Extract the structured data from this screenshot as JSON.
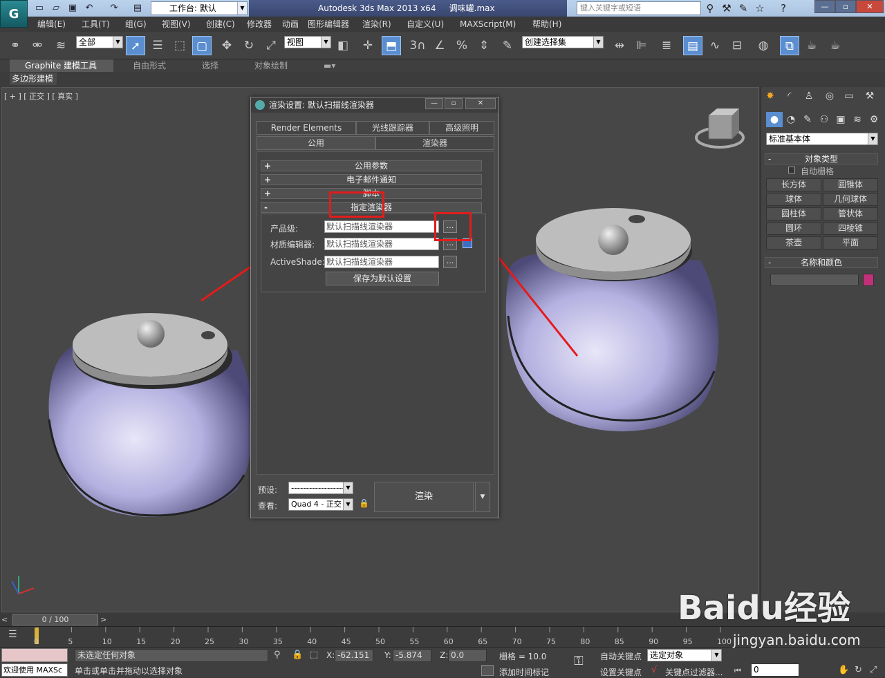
{
  "title": {
    "workspace": "工作台: 默认",
    "app_title": "Autodesk 3ds Max  2013 x64",
    "file_name": "调味罐.max",
    "search_placeholder": "键入关键字或短语"
  },
  "menus": [
    "编辑(E)",
    "工具(T)",
    "组(G)",
    "视图(V)",
    "创建(C)",
    "修改器",
    "动画",
    "图形编辑器",
    "渲染(R)",
    "自定义(U)",
    "MAXScript(M)",
    "帮助(H)"
  ],
  "toolbar": {
    "filter": "全部",
    "ref_coord": "视图",
    "selection_set": "创建选择集",
    "snap_value": "3"
  },
  "ribbon": {
    "tabs": [
      "Graphite 建模工具",
      "自由形式",
      "选择",
      "对象绘制"
    ],
    "sub_tab": "多边形建模"
  },
  "viewport": {
    "label": "[ + ] [ 正交 ] [ 真实 ]"
  },
  "dialog": {
    "title": "渲染设置: 默认扫描线渲染器",
    "tabs_row1": [
      "Render Elements",
      "光线跟踪器",
      "高级照明"
    ],
    "tabs_row2": [
      "公用",
      "渲染器"
    ],
    "rollouts": [
      {
        "sign": "+",
        "label": "公用参数"
      },
      {
        "sign": "+",
        "label": "电子邮件通知"
      },
      {
        "sign": "+",
        "label": "脚本"
      },
      {
        "sign": "-",
        "label": "指定渲染器"
      }
    ],
    "renderer_rows": [
      {
        "label": "产品级:",
        "value": "默认扫描线渲染器"
      },
      {
        "label": "材质编辑器:",
        "value": "默认扫描线渲染器"
      },
      {
        "label": "ActiveShade:",
        "value": "默认扫描线渲染器"
      }
    ],
    "dots_label": "...",
    "save_default": "保存为默认设置",
    "preset_label": "预设:",
    "preset_value": "------------------",
    "view_label": "查看:",
    "view_value": "Quad 4 - 正交",
    "render_button": "渲染"
  },
  "command_panel": {
    "category": "标准基本体",
    "object_type_title": "对象类型",
    "auto_grid": "自动栅格",
    "buttons": [
      "长方体",
      "圆锥体",
      "球体",
      "几何球体",
      "圆柱体",
      "管状体",
      "圆环",
      "四棱锥",
      "茶壶",
      "平面"
    ],
    "name_color_title": "名称和颜色",
    "swatch_color": "#c2307a"
  },
  "timeline": {
    "frame": "0 / 100",
    "ticks": [
      "0",
      "5",
      "10",
      "15",
      "20",
      "25",
      "30",
      "35",
      "40",
      "45",
      "50",
      "55",
      "60",
      "65",
      "70",
      "75",
      "80",
      "85",
      "90",
      "95",
      "100"
    ]
  },
  "status": {
    "welcome": "欢迎使用 MAXSc",
    "selection": "未选定任何对象",
    "prompt": "单击或单击并拖动以选择对象",
    "x_label": "X:",
    "x": "-62.151",
    "y_label": "Y:",
    "y": "-5.874",
    "z_label": "Z:",
    "z": "0.0",
    "grid": "栅格 = 10.0",
    "add_time_tag": "添加时间标记",
    "auto_key": "自动关键点",
    "set_key": "设置关键点",
    "selected_object": "选定对象",
    "key_filter": "关键点过滤器...",
    "frame_field": "0"
  },
  "watermark": {
    "brand": "Baidu经验",
    "url": "jingyan.baidu.com"
  }
}
